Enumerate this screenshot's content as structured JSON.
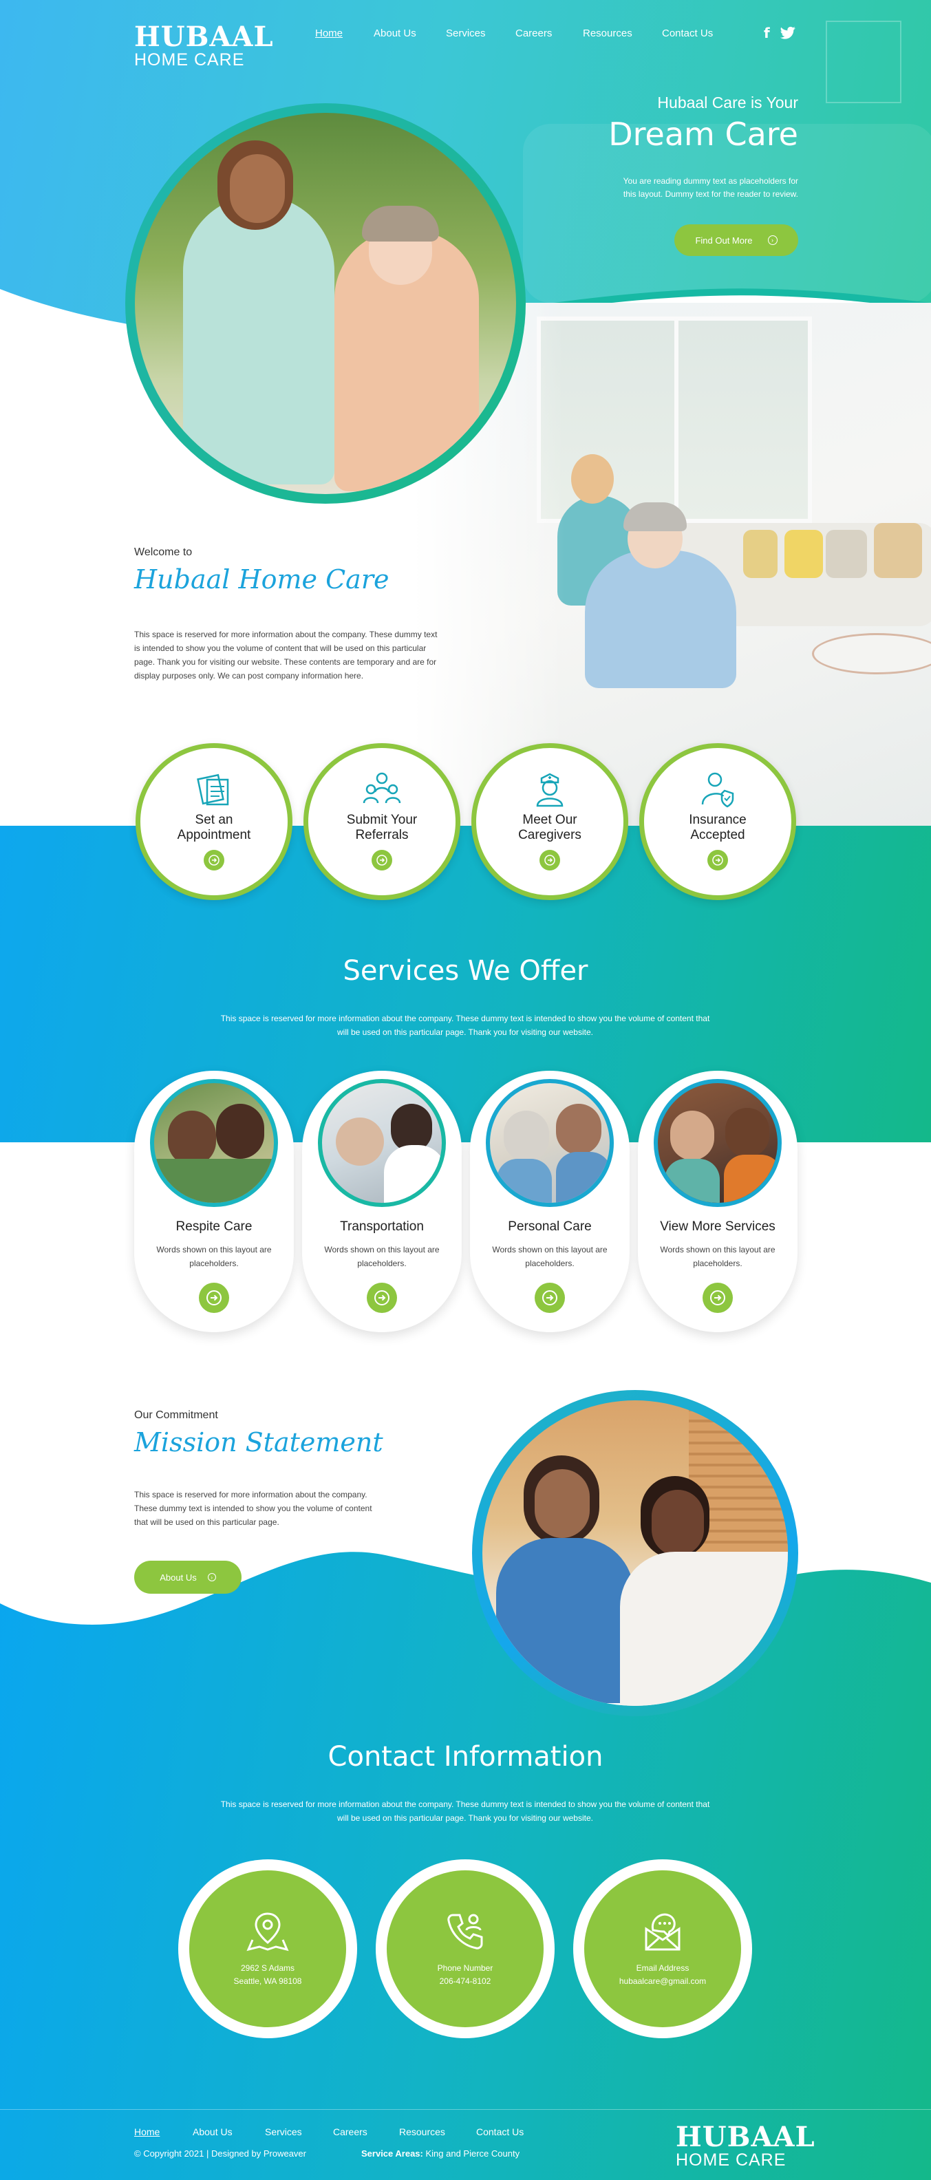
{
  "logo": {
    "title": "HUBAAL",
    "subtitle": "HOME CARE"
  },
  "nav": {
    "items": [
      {
        "label": "Home",
        "active": true
      },
      {
        "label": "About Us",
        "active": false
      },
      {
        "label": "Services",
        "active": false
      },
      {
        "label": "Careers",
        "active": false
      },
      {
        "label": "Resources",
        "active": false
      },
      {
        "label": "Contact Us",
        "active": false
      }
    ],
    "social": [
      "facebook-icon",
      "twitter-icon"
    ]
  },
  "hero": {
    "tagline": "Hubaal Care is Your",
    "script": "Dream Care",
    "desc_line1": "You are reading dummy text as placeholders for",
    "desc_line2": "this layout. Dummy text for the reader to review.",
    "cta": "Find Out More"
  },
  "welcome": {
    "kicker": "Welcome to",
    "script": "Hubaal Home Care",
    "lines": [
      "This space is reserved for more information about the company. These dummy text",
      "is intended to show you the volume of content that will be used on this particular",
      "page. Thank you for visiting our website. These contents are temporary and are for",
      "display purposes only. We can post company information here."
    ]
  },
  "features": [
    {
      "line1": "Set an",
      "line2": "Appointment",
      "icon": "appointment-icon"
    },
    {
      "line1": "Submit Your",
      "line2": "Referrals",
      "icon": "referrals-icon"
    },
    {
      "line1": "Meet Our",
      "line2": "Caregivers",
      "icon": "nurse-icon"
    },
    {
      "line1": "Insurance",
      "line2": "Accepted",
      "icon": "insurance-icon"
    }
  ],
  "services": {
    "heading": "Services We Offer",
    "desc_line1": "This space is reserved for more information about the company. These dummy text is intended to show you the volume of content that",
    "desc_line2": "will be used on this particular page. Thank you for visiting our website.",
    "cards": [
      {
        "title": "Respite Care",
        "desc_line1": "Words shown on this layout are",
        "desc_line2": "placeholders."
      },
      {
        "title": "Transportation",
        "desc_line1": "Words shown on this layout are",
        "desc_line2": "placeholders."
      },
      {
        "title": "Personal Care",
        "desc_line1": "Words shown on this layout are",
        "desc_line2": "placeholders."
      },
      {
        "title": "View More Services",
        "desc_line1": "Words shown on this layout are",
        "desc_line2": "placeholders."
      }
    ]
  },
  "mission": {
    "kicker": "Our Commitment",
    "script": "Mission Statement",
    "lines": [
      "This space is reserved for more information about the company.",
      "These dummy text is intended to show you the volume of content",
      "that will be used on this particular page."
    ],
    "cta": "About Us"
  },
  "contact": {
    "heading": "Contact Information",
    "desc_line1": "This space is reserved for more information about the company. These dummy text is intended to show you the volume of content that",
    "desc_line2": "will be used on this particular page. Thank you for visiting our website.",
    "items": [
      {
        "icon": "map-pin-icon",
        "line1": "2962 S Adams",
        "line2": "Seattle, WA 98108"
      },
      {
        "icon": "phone-icon",
        "line1": "Phone Number",
        "line2": "206-474-8102"
      },
      {
        "icon": "mail-icon",
        "line1": "Email Address",
        "line2": "hubaalcare@gmail.com"
      }
    ]
  },
  "footer": {
    "links": [
      {
        "label": "Home",
        "active": true
      },
      {
        "label": "About Us",
        "active": false
      },
      {
        "label": "Services",
        "active": false
      },
      {
        "label": "Careers",
        "active": false
      },
      {
        "label": "Resources",
        "active": false
      },
      {
        "label": "Contact Us",
        "active": false
      }
    ],
    "copyright": "© Copyright 2021 | Designed by Proweaver",
    "service_areas_label": "Service Areas:",
    "service_areas_value": "King and Pierce County"
  },
  "colors": {
    "accent_green": "#8dc63f",
    "teal": "#14b8a6",
    "blue": "#0ea7ee",
    "script_blue": "#1ba3dc"
  }
}
